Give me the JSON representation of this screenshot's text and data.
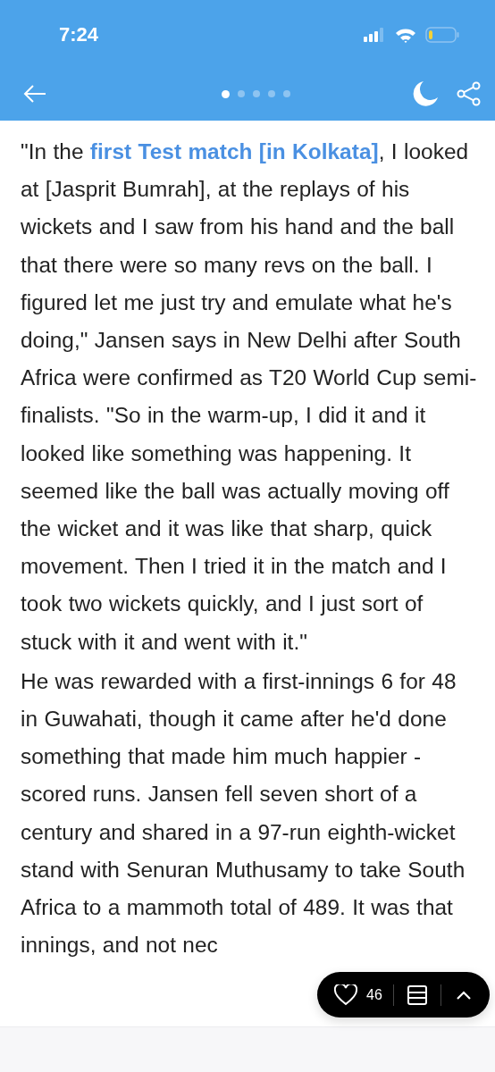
{
  "status_bar": {
    "time": "7:24"
  },
  "toolbar": {
    "page_dots": [
      {
        "selected": true
      },
      {
        "selected": false
      },
      {
        "selected": false
      },
      {
        "selected": false
      },
      {
        "selected": false
      }
    ]
  },
  "article": {
    "paragraphs": [
      {
        "before": "\"In the ",
        "link": "first Test match [in Kolkata]",
        "after": ", I looked at [Jasprit Bumrah], at the replays of his wickets and I saw from his hand and the ball that there were so many revs on the ball. I figured let me just try and emulate what he's doing,\" Jansen says in New Delhi after South Africa were confirmed as T20 World Cup semi-finalists. \"So in the warm-up, I did it and it looked like something was happening. It seemed like the ball was actually moving off the wicket and it was like that sharp, quick movement. Then I tried it in the match and I took two wickets quickly, and I just sort of stuck with it and went with it.\""
      },
      {
        "before": "He was rewarded with a first-innings 6 for 48 in Guwahati, though it came after he'd done something that made him much happier - scored runs. Jansen fell seven short of a century and shared in a 97-run eighth-wicket stand with Senuran Muthusamy to take South Africa to a mammoth total of 489. It was that innings, and not nec"
      }
    ]
  },
  "action_pill": {
    "likes": "46",
    "liked": false
  }
}
